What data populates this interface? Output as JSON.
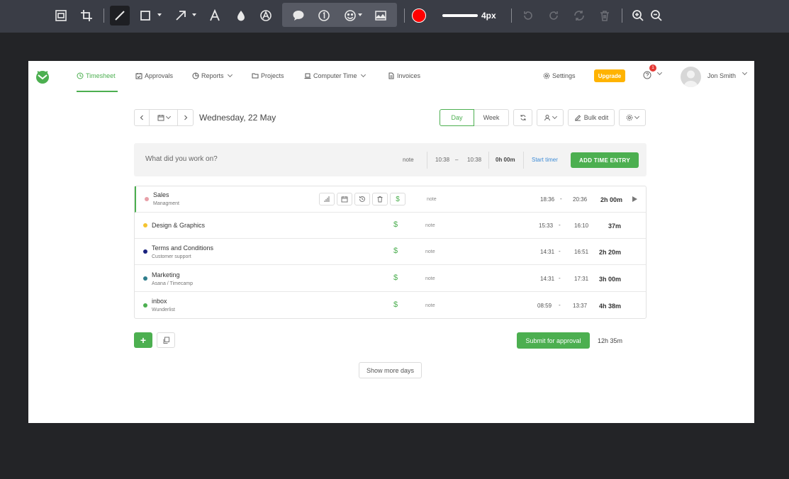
{
  "toolbar": {
    "stroke_width": "4px",
    "color": "#ff0000"
  },
  "nav": {
    "items": [
      {
        "label": "Timesheet"
      },
      {
        "label": "Approvals"
      },
      {
        "label": "Reports"
      },
      {
        "label": "Projects"
      },
      {
        "label": "Computer Time"
      },
      {
        "label": "Invoices"
      }
    ],
    "settings": "Settings",
    "upgrade": "Upgrade",
    "help_badge": "1",
    "user_name": "Jon Smith"
  },
  "date_bar": {
    "date": "Wednesday, 22 May",
    "view_day": "Day",
    "view_week": "Week",
    "bulk_edit": "Bulk edit"
  },
  "entry_bar": {
    "placeholder": "What did you work on?",
    "note": "note",
    "start": "10:38",
    "dash": "–",
    "end": "10:38",
    "duration": "0h 00m",
    "start_timer": "Start timer",
    "add_button": "ADD TIME ENTRY"
  },
  "entries": [
    {
      "title": "Sales",
      "subtitle": "Managment",
      "color": "#e8a0a8",
      "note": "note",
      "start": "18:36",
      "end": "20:36",
      "duration": "2h 00m"
    },
    {
      "title": "Design & Graphics",
      "subtitle": "",
      "color": "#f4c430",
      "note": "note",
      "start": "15:33",
      "end": "16:10",
      "duration": "37m"
    },
    {
      "title": "Terms and Conditions",
      "subtitle": "Customer support",
      "color": "#1a237e",
      "note": "note",
      "start": "14:31",
      "end": "16:51",
      "duration": "2h 20m"
    },
    {
      "title": "Marketing",
      "subtitle": "Asana / Timecamp",
      "color": "#2e7d8c",
      "note": "note",
      "start": "14:31",
      "end": "17:31",
      "duration": "3h 00m"
    },
    {
      "title": "inbox",
      "subtitle": "Wunderlist",
      "color": "#4caf50",
      "note": "note",
      "start": "08:59",
      "end": "13:37",
      "duration": "4h 38m"
    }
  ],
  "entry_dash": "-",
  "entry_dollar": "$",
  "footer": {
    "plus": "+",
    "submit": "Submit for approval",
    "total": "12h 35m",
    "show_more": "Show more days"
  }
}
